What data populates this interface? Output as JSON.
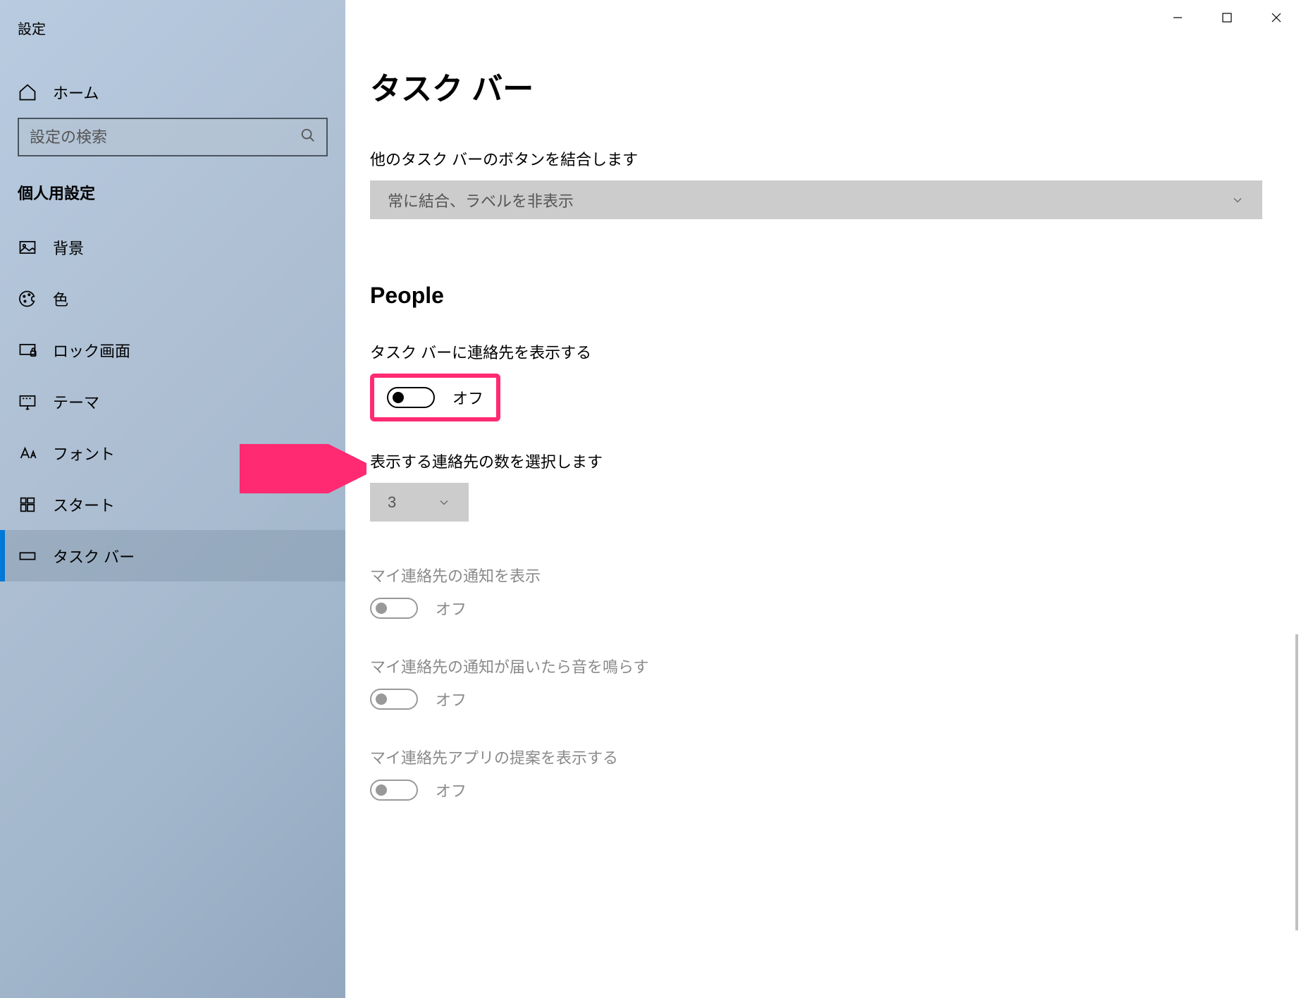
{
  "window_title": "設定",
  "search": {
    "placeholder": "設定の検索"
  },
  "sidebar": {
    "home_label": "ホーム",
    "section_label": "個人用設定",
    "items": [
      {
        "label": "背景",
        "icon": "image-icon",
        "active": false
      },
      {
        "label": "色",
        "icon": "palette-icon",
        "active": false
      },
      {
        "label": "ロック画面",
        "icon": "lock-screen-icon",
        "active": false
      },
      {
        "label": "テーマ",
        "icon": "theme-icon",
        "active": false
      },
      {
        "label": "フォント",
        "icon": "font-icon",
        "active": false
      },
      {
        "label": "スタート",
        "icon": "start-icon",
        "active": false
      },
      {
        "label": "タスク バー",
        "icon": "taskbar-icon",
        "active": true
      }
    ]
  },
  "main": {
    "title": "タスク バー",
    "combine_label": "他のタスク バーのボタンを結合します",
    "combine_value": "常に結合、ラベルを非表示",
    "people_heading": "People",
    "show_contacts": {
      "label": "タスク バーに連絡先を表示する",
      "state": "オフ"
    },
    "count_label": "表示する連絡先の数を選択します",
    "count_value": "3",
    "notify": {
      "label": "マイ連絡先の通知を表示",
      "state": "オフ"
    },
    "sound": {
      "label": "マイ連絡先の通知が届いたら音を鳴らす",
      "state": "オフ"
    },
    "suggest": {
      "label": "マイ連絡先アプリの提案を表示する",
      "state": "オフ"
    }
  }
}
